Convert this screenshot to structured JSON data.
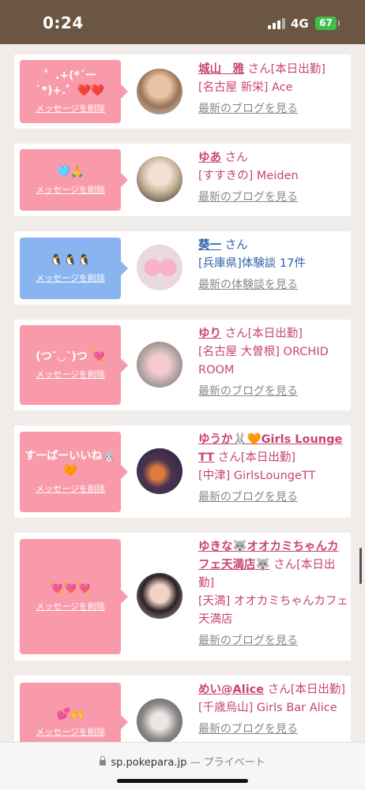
{
  "status": {
    "time": "0:24",
    "network": "4G",
    "battery": "67"
  },
  "colors": {
    "pink_bubble": "#f99aaa",
    "blue_bubble": "#8ab4f0",
    "name_pink": "#c8456a",
    "name_blue": "#2e63a8"
  },
  "cards": [
    {
      "message": "゜.+(*´ー`*)+.゜❤️❤️",
      "delete": "メッセージを削除",
      "name": "城山　雅",
      "san": "さん[本日出勤]",
      "location": "[名古屋 新栄] Ace",
      "link": "最新のブログを見る"
    },
    {
      "message": "🩵🙏",
      "delete": "メッセージを削除",
      "name": "ゆあ",
      "san": "さん",
      "location": "[すすきの] Meiden",
      "link": "最新のブログを見る"
    },
    {
      "message": "🐧🐧🐧",
      "delete": "メッセージを削除",
      "name": "葵一",
      "san": "さん",
      "location": "[兵庫県]体験談 17件",
      "link": "最新の体験談を見る"
    },
    {
      "message": "(つ˘◡˘)つ 💘",
      "delete": "メッセージを削除",
      "name": "ゆり",
      "san": "さん[本日出勤]",
      "location": "[名古屋 大曽根] ORCHID ROOM",
      "link": "最新のブログを見る"
    },
    {
      "message": "すーぱーいいね🐰🧡",
      "delete": "メッセージを削除",
      "name": "ゆうか🐰🧡Girls Lounge TT",
      "san": "さん[本日出勤]",
      "location": "[中津] GirlsLoungeTT",
      "link": "最新のブログを見る"
    },
    {
      "message": "💘💘💘",
      "delete": "メッセージを削除",
      "name": "ゆきな🐺オオカミちゃんカフェ天満店🐺",
      "san": "さん[本日出勤]",
      "location": "[天満] オオカミちゃんカフェ天満店",
      "link": "最新のブログを見る"
    },
    {
      "message": "💕🙌",
      "delete": "メッセージを削除",
      "name": "めい@Alice",
      "san": "さん[本日出勤]",
      "location": "[千歳烏山] Girls Bar Alice",
      "link": "最新のブログを見る"
    }
  ],
  "browser": {
    "url": "sp.pokepara.jp",
    "mode": "— プライベート"
  }
}
